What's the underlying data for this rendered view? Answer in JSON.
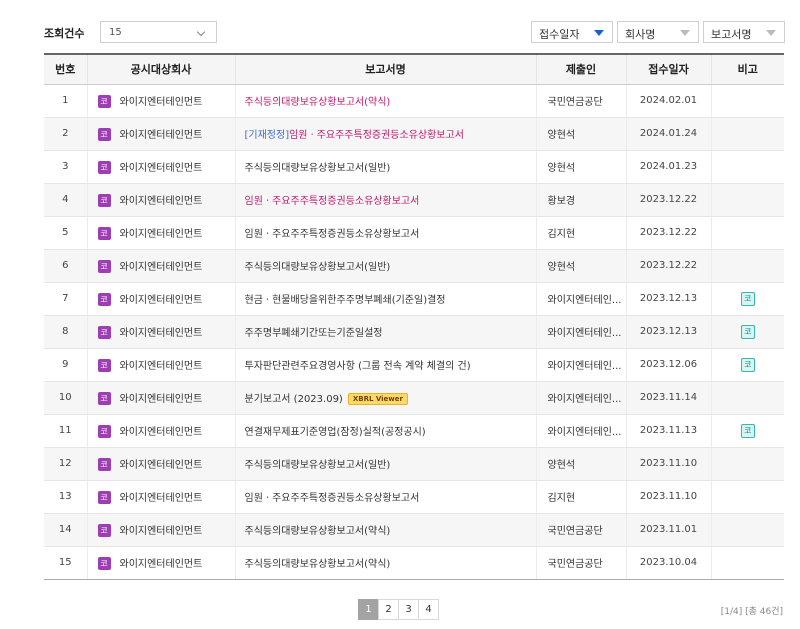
{
  "toolbar": {
    "count_label": "조회건수",
    "count_value": "15",
    "sort_date": "접수일자",
    "sort_company": "회사명",
    "sort_report": "보고서명"
  },
  "table": {
    "headers": [
      "번호",
      "공시대상회사",
      "보고서명",
      "제출인",
      "접수일자",
      "비고"
    ],
    "company_marker": "코",
    "remark_marker": "코",
    "rows": [
      {
        "no": "1",
        "company": "와이지엔터테인먼트",
        "report_prefix": "",
        "report": "주식등의대량보유상황보고서(약식)",
        "submitter": "국민연금공단",
        "date": "2024.02.01"
      },
      {
        "no": "2",
        "company": "와이지엔터테인먼트",
        "report_prefix": "[기재정정]",
        "report": "임원ㆍ주요주주특정증권등소유상황보고서",
        "submitter": "양현석",
        "date": "2024.01.24"
      },
      {
        "no": "3",
        "company": "와이지엔터테인먼트",
        "report_prefix": "",
        "report": "주식등의대량보유상황보고서(일반)",
        "submitter": "양현석",
        "date": "2024.01.23"
      },
      {
        "no": "4",
        "company": "와이지엔터테인먼트",
        "report_prefix": "",
        "report": "임원ㆍ주요주주특정증권등소유상황보고서",
        "submitter": "황보경",
        "date": "2023.12.22"
      },
      {
        "no": "5",
        "company": "와이지엔터테인먼트",
        "report_prefix": "",
        "report": "임원ㆍ주요주주특정증권등소유상황보고서",
        "submitter": "김지현",
        "date": "2023.12.22"
      },
      {
        "no": "6",
        "company": "와이지엔터테인먼트",
        "report_prefix": "",
        "report": "주식등의대량보유상황보고서(일반)",
        "submitter": "양현석",
        "date": "2023.12.22"
      },
      {
        "no": "7",
        "company": "와이지엔터테인먼트",
        "report_prefix": "",
        "report": "현금ㆍ현물배당을위한주주명부폐쇄(기준일)결정",
        "submitter": "와이지엔터테인...",
        "date": "2023.12.13",
        "remark": true
      },
      {
        "no": "8",
        "company": "와이지엔터테인먼트",
        "report_prefix": "",
        "report": "주주명부폐쇄기간또는기준일설정",
        "submitter": "와이지엔터테인...",
        "date": "2023.12.13",
        "remark": true
      },
      {
        "no": "9",
        "company": "와이지엔터테인먼트",
        "report_prefix": "",
        "report": "투자판단관련주요경영사항 (그룹 전속 계약 체결의 건)",
        "submitter": "와이지엔터테인...",
        "date": "2023.12.06",
        "remark": true
      },
      {
        "no": "10",
        "company": "와이지엔터테인먼트",
        "report_prefix": "",
        "report": "분기보고서 (2023.09)",
        "badge": "XBRL Viewer",
        "submitter": "와이지엔터테인...",
        "date": "2023.11.14"
      },
      {
        "no": "11",
        "company": "와이지엔터테인먼트",
        "report_prefix": "",
        "report": "연결재무제표기준영업(잠정)실적(공정공시)",
        "submitter": "와이지엔터테인...",
        "date": "2023.11.13",
        "remark": true
      },
      {
        "no": "12",
        "company": "와이지엔터테인먼트",
        "report_prefix": "",
        "report": "주식등의대량보유상황보고서(일반)",
        "submitter": "양현석",
        "date": "2023.11.10"
      },
      {
        "no": "13",
        "company": "와이지엔터테인먼트",
        "report_prefix": "",
        "report": "임원ㆍ주요주주특정증권등소유상황보고서",
        "submitter": "김지현",
        "date": "2023.11.10"
      },
      {
        "no": "14",
        "company": "와이지엔터테인먼트",
        "report_prefix": "",
        "report": "주식등의대량보유상황보고서(약식)",
        "submitter": "국민연금공단",
        "date": "2023.11.01"
      },
      {
        "no": "15",
        "company": "와이지엔터테인먼트",
        "report_prefix": "",
        "report": "주식등의대량보유상황보고서(약식)",
        "submitter": "국민연금공단",
        "date": "2023.10.04"
      }
    ]
  },
  "pagination": {
    "pages": [
      "1",
      "2",
      "3",
      "4"
    ],
    "current": "1",
    "info": "[1/4] [총 46건]"
  },
  "colors": {
    "company_marker": "#9d3fb2",
    "report_highlight": "#c2186f",
    "correction_prefix": "#3c6bd1",
    "remark_marker": "#35b7ae",
    "xbrl_badge": "#ffd76a"
  }
}
